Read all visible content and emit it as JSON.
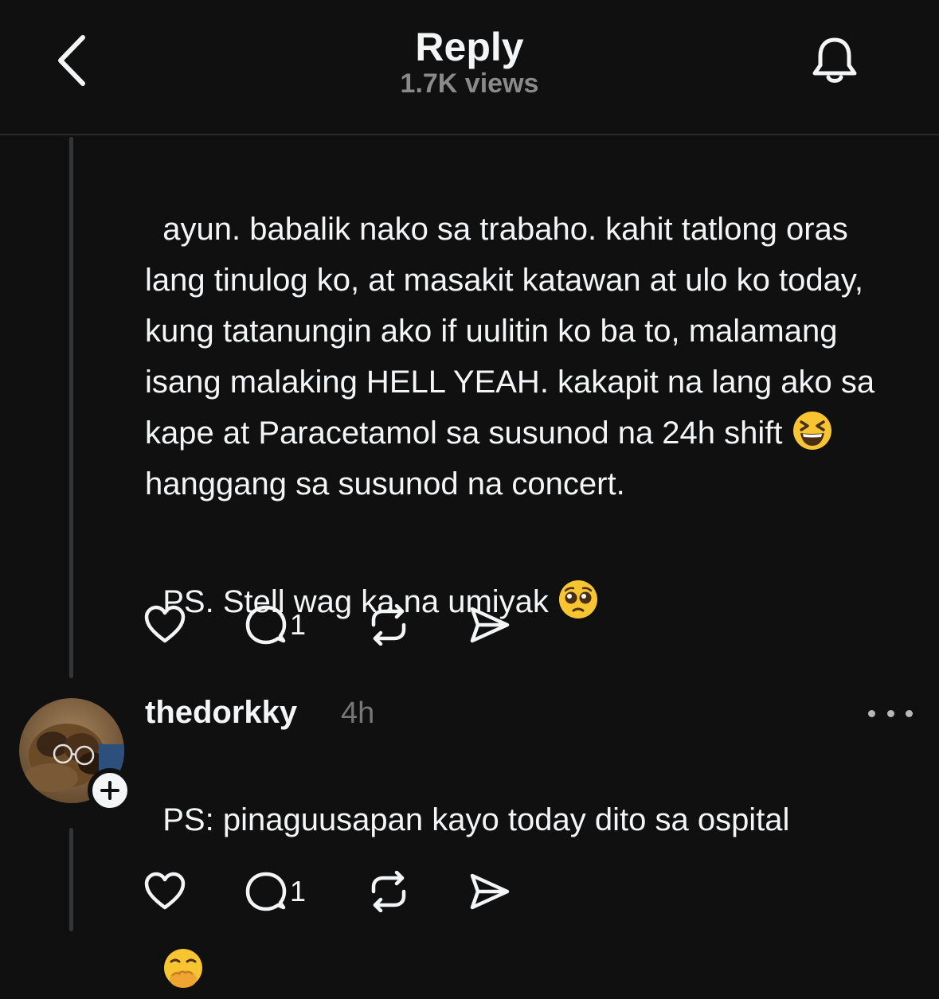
{
  "header": {
    "title": "Reply",
    "subtitle": "1.7K views",
    "back_icon": "chevron-left-icon",
    "bell_icon": "bell-icon"
  },
  "post": {
    "paragraph1_before_emoji": "ayun. babalik nako sa trabaho. kahit tatlong oras lang tinulog ko, at masakit katawan at ulo ko today, kung tatanungin ako if uulitin ko ba to, malamang isang malaking HELL YEAH. kakapit na lang ako sa kape at Paracetamol sa susunod na 24h shift ",
    "paragraph1_emoji": "grinning-squinting-face-emoji",
    "paragraph1_after_emoji": "\nhanggang sa susunod na concert.",
    "paragraph2": "PS. Stell wag ka na umiyak ",
    "paragraph2_emoji": "pleading-face-emoji",
    "actions": {
      "like_icon": "heart-icon",
      "comment_icon": "comment-icon",
      "comment_count": "1",
      "repost_icon": "repost-icon",
      "share_icon": "send-icon"
    }
  },
  "reply": {
    "username": "thedorkky",
    "time": "4h",
    "text": "PS: pinaguusapan kayo today dito sa ospital",
    "text_emoji": "face-with-hand-over-mouth-emoji",
    "follow_icon": "plus-icon",
    "more_icon": "more-horizontal-icon",
    "actions": {
      "like_icon": "heart-icon",
      "comment_icon": "comment-icon",
      "comment_count": "1",
      "repost_icon": "repost-icon",
      "share_icon": "send-icon"
    }
  },
  "colors": {
    "background": "#101010",
    "text": "#f3f5f7",
    "muted": "#777777",
    "thread_line": "#333638"
  }
}
